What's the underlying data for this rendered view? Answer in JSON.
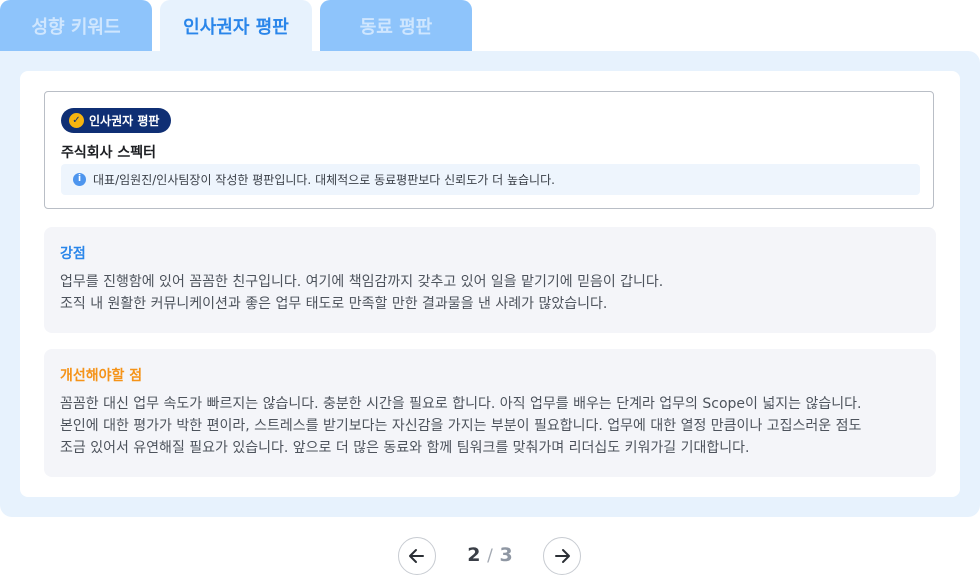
{
  "tabs": [
    {
      "label": "성향 키워드",
      "active": false
    },
    {
      "label": "인사권자 평판",
      "active": true
    },
    {
      "label": "동료 평판",
      "active": false
    }
  ],
  "review": {
    "badge_label": "인사권자 평판",
    "company_name": "주식회사 스펙터",
    "info_text": "대표/임원진/인사팀장이 작성한 평판입니다. 대체적으로 동료평판보다 신뢰도가 더 높습니다."
  },
  "strengths": {
    "title": "강점",
    "body": "업무를 진행함에 있어 꼼꼼한 친구입니다. 여기에 책임감까지 갖추고 있어 일을 맡기기에 믿음이 갑니다.\n조직 내 원활한 커뮤니케이션과 좋은 업무 태도로 만족할 만한 결과물을 낸 사례가 많았습니다."
  },
  "improvements": {
    "title": "개선해야할 점",
    "body": "꼼꼼한 대신 업무 속도가 빠르지는 않습니다. 충분한 시간을 필요로 합니다. 아직 업무를 배우는 단계라 업무의 Scope이 넓지는 않습니다.\n본인에 대한 평가가 박한 편이라, 스트레스를 받기보다는 자신감을 가지는 부분이 필요합니다. 업무에 대한 열정 만큼이나 고집스러운 점도\n조금 있어서 유연해질 필요가 있습니다. 앞으로 더 많은 동료와 함께 팀워크를 맞춰가며 리더십도 키워가길 기대합니다."
  },
  "pagination": {
    "current": "2",
    "separator": "/",
    "total": "3"
  },
  "colors": {
    "accent": "#2a86ea",
    "badge": "#0f2f74",
    "warning": "#f59318"
  }
}
